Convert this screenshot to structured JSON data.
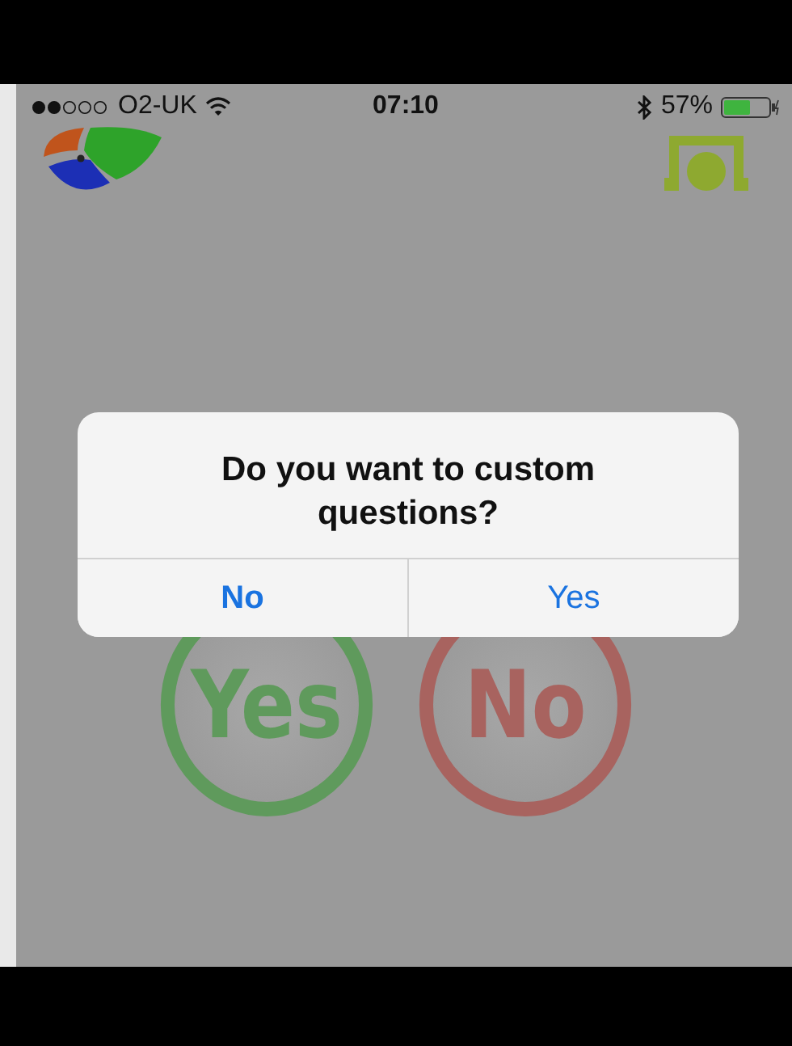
{
  "status_bar": {
    "carrier": "O2-UK",
    "time": "07:10",
    "battery": "57%"
  },
  "choice_buttons": [
    {
      "label": "Yes",
      "kind": "yes"
    },
    {
      "label": "No",
      "kind": "no"
    }
  ],
  "dialog": {
    "message": "Do you want to custom questions?",
    "buttons": [
      "No",
      "Yes"
    ]
  }
}
